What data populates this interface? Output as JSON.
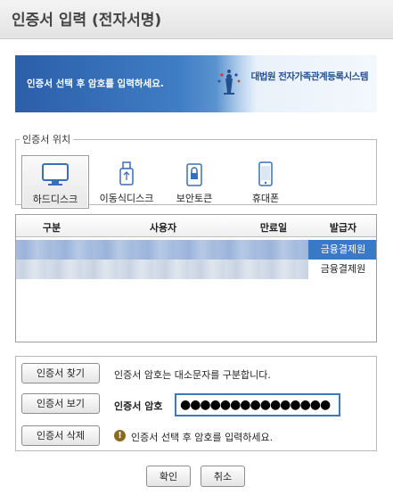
{
  "window": {
    "title": "인증서 입력 (전자서명)"
  },
  "banner": {
    "text": "인증서 선택 후 암호를 입력하세요.",
    "org_name": "대법원 전자가족관계등록시스템",
    "emblem_icon": "court-emblem-icon"
  },
  "location": {
    "legend": "인증서 위치",
    "items": [
      {
        "label": "하드디스크",
        "icon": "monitor-icon",
        "selected": true
      },
      {
        "label": "이동식디스크",
        "icon": "usb-icon",
        "selected": false
      },
      {
        "label": "보안토큰",
        "icon": "security-token-icon",
        "selected": false
      },
      {
        "label": "휴대폰",
        "icon": "mobile-phone-icon",
        "selected": false
      }
    ]
  },
  "table": {
    "headers": [
      "구분",
      "사용자",
      "만료일",
      "발급자"
    ],
    "rows": [
      {
        "issuer": "금융결제원",
        "selected": true
      },
      {
        "issuer": "금융결제원",
        "selected": false
      }
    ]
  },
  "actions": {
    "find": "인증서 찾기",
    "view": "인증서 보기",
    "delete": "인증서 삭제"
  },
  "info": {
    "case_notice": "인증서 암호는 대소문자를 구분합니다.",
    "password_label": "인증서 암호",
    "password_value": "●●●●●●●●●●●●●●●",
    "warning": "인증서 선택 후 암호를 입력하세요.",
    "warning_icon": "!"
  },
  "footer": {
    "ok": "확인",
    "cancel": "취소"
  },
  "colors": {
    "accent": "#3a78c8",
    "banner": "#2b5fa8"
  }
}
